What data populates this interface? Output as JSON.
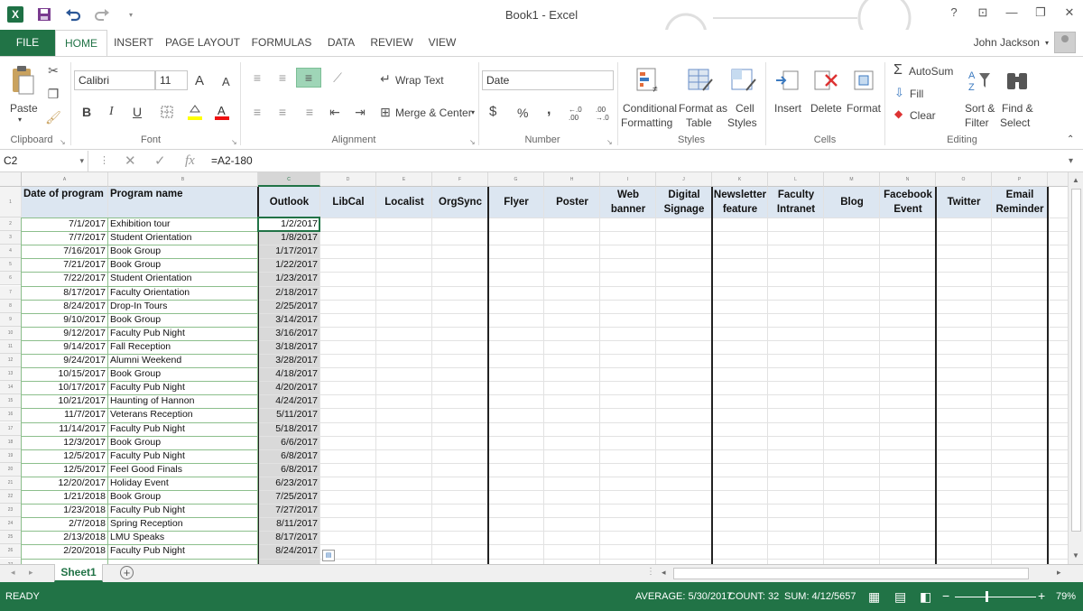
{
  "window": {
    "title": "Book1 - Excel",
    "help": "?",
    "controls": [
      "⊡",
      "—",
      "❐",
      "✕"
    ]
  },
  "qat": {
    "app_icon": "excel-icon",
    "save": "save-icon",
    "undo": "undo-icon",
    "redo": "redo-icon"
  },
  "tabs": [
    "FILE",
    "HOME",
    "INSERT",
    "PAGE LAYOUT",
    "FORMULAS",
    "DATA",
    "REVIEW",
    "VIEW"
  ],
  "user": {
    "name": "John Jackson"
  },
  "ribbon": {
    "clipboard": {
      "label": "Clipboard",
      "paste": "Paste"
    },
    "font": {
      "label": "Font",
      "name": "Calibri",
      "size": "11",
      "bold": "B",
      "italic": "I",
      "underline": "U"
    },
    "alignment": {
      "label": "Alignment",
      "wrap": "Wrap Text",
      "merge": "Merge & Center"
    },
    "number": {
      "label": "Number",
      "format": "Date",
      "currency": "$",
      "percent": "%",
      "comma": ","
    },
    "styles": {
      "label": "Styles",
      "conditional1": "Conditional",
      "conditional2": "Formatting",
      "format_table1": "Format as",
      "format_table2": "Table",
      "cell_styles1": "Cell",
      "cell_styles2": "Styles"
    },
    "cells": {
      "label": "Cells",
      "insert": "Insert",
      "delete": "Delete",
      "format": "Format"
    },
    "editing": {
      "label": "Editing",
      "autosum": "AutoSum",
      "fill": "Fill",
      "clear": "Clear",
      "sort1": "Sort &",
      "sort2": "Filter",
      "find1": "Find &",
      "find2": "Select"
    }
  },
  "formula_bar": {
    "name_box": "C2",
    "fx": "fx",
    "formula": "=A2-180"
  },
  "sheet": {
    "col_letters": [
      "A",
      "B",
      "C",
      "D",
      "E",
      "F",
      "G",
      "H",
      "I",
      "J",
      "K",
      "L",
      "M",
      "N",
      "O",
      "P"
    ],
    "headers": [
      [
        "Date of program"
      ],
      [
        "Program name"
      ],
      [
        "Outlook"
      ],
      [
        "LibCal"
      ],
      [
        "Localist"
      ],
      [
        "OrgSync"
      ],
      [
        "Flyer"
      ],
      [
        "Poster"
      ],
      [
        "Web",
        "banner"
      ],
      [
        "Digital",
        "Signage"
      ],
      [
        "Newsletter",
        "feature"
      ],
      [
        "Faculty",
        "Intranet"
      ],
      [
        "Blog"
      ],
      [
        "Facebook",
        "Event"
      ],
      [
        "Twitter"
      ],
      [
        "Email",
        "Reminder"
      ]
    ],
    "rows": [
      [
        "7/1/2017",
        "Exhibition tour",
        "1/2/2017"
      ],
      [
        "7/7/2017",
        "Student Orientation",
        "1/8/2017"
      ],
      [
        "7/16/2017",
        "Book Group",
        "1/17/2017"
      ],
      [
        "7/21/2017",
        "Book Group",
        "1/22/2017"
      ],
      [
        "7/22/2017",
        "Student Orientation",
        "1/23/2017"
      ],
      [
        "8/17/2017",
        "Faculty Orientation",
        "2/18/2017"
      ],
      [
        "8/24/2017",
        "Drop-In Tours",
        "2/25/2017"
      ],
      [
        "9/10/2017",
        "Book Group",
        "3/14/2017"
      ],
      [
        "9/12/2017",
        "Faculty Pub Night",
        "3/16/2017"
      ],
      [
        "9/14/2017",
        "Fall Reception",
        "3/18/2017"
      ],
      [
        "9/24/2017",
        "Alumni Weekend",
        "3/28/2017"
      ],
      [
        "10/15/2017",
        "Book Group",
        "4/18/2017"
      ],
      [
        "10/17/2017",
        "Faculty Pub Night",
        "4/20/2017"
      ],
      [
        "10/21/2017",
        "Haunting of Hannon",
        "4/24/2017"
      ],
      [
        "11/7/2017",
        "Veterans Reception",
        "5/11/2017"
      ],
      [
        "11/14/2017",
        "Faculty Pub Night",
        "5/18/2017"
      ],
      [
        "12/3/2017",
        "Book Group",
        "6/6/2017"
      ],
      [
        "12/5/2017",
        "Faculty Pub Night",
        "6/8/2017"
      ],
      [
        "12/5/2017",
        "Feel Good Finals",
        "6/8/2017"
      ],
      [
        "12/20/2017",
        "Holiday Event",
        "6/23/2017"
      ],
      [
        "1/21/2018",
        "Book Group",
        "7/25/2017"
      ],
      [
        "1/23/2018",
        "Faculty Pub Night",
        "7/27/2017"
      ],
      [
        "2/7/2018",
        "Spring Reception",
        "8/11/2017"
      ],
      [
        "2/13/2018",
        "LMU Speaks",
        "8/17/2017"
      ],
      [
        "2/20/2018",
        "Faculty Pub Night",
        "8/24/2017"
      ]
    ]
  },
  "sheet_tabs": {
    "active": "Sheet1",
    "add": "+"
  },
  "status": {
    "ready": "READY",
    "average": "AVERAGE: 5/30/2017",
    "count": "COUNT: 32",
    "sum": "SUM: 4/12/5657",
    "zoom": "79%",
    "zoom_level": 0.79
  },
  "colors": {
    "accent": "#217346",
    "header_fill": "#dce6f1",
    "selected_col": "#d9d9d9"
  }
}
